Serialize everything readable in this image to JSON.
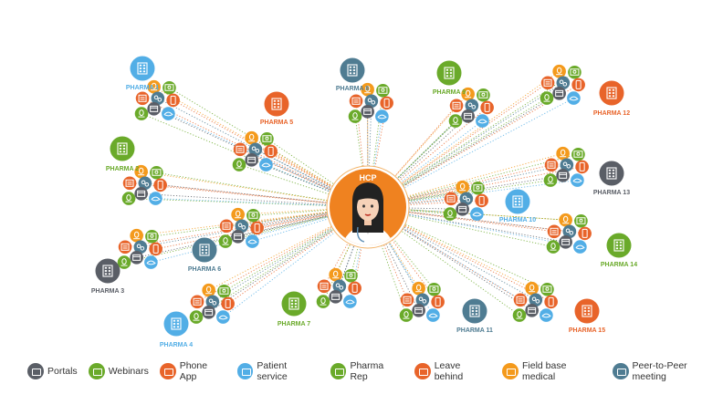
{
  "center": {
    "label": "HCP"
  },
  "colors": {
    "portals": "#5a5e66",
    "webinars": "#6aaa2a",
    "phone_app": "#e8642a",
    "patient_service": "#52aee6",
    "pharma_rep": "#6aaa2a",
    "leave_behind": "#e8642a",
    "field_base_medical": "#f49a1c",
    "peer_to_peer": "#4f7c92",
    "hcp": "#ef8220"
  },
  "pharmas": [
    {
      "label": "PHARMA 1",
      "color": "#52aee6"
    },
    {
      "label": "PHARMA 2",
      "color": "#6aaa2a"
    },
    {
      "label": "PHARMA 3",
      "color": "#5a5e66"
    },
    {
      "label": "PHARMA 4",
      "color": "#52aee6"
    },
    {
      "label": "PHARMA 5",
      "color": "#e8642a"
    },
    {
      "label": "PHARMA 6",
      "color": "#4f7c92"
    },
    {
      "label": "PHARMA 7",
      "color": "#6aaa2a"
    },
    {
      "label": "PHARMA 8",
      "color": "#4f7c92"
    },
    {
      "label": "PHARMA 9",
      "color": "#6aaa2a"
    },
    {
      "label": "PHARMA 10",
      "color": "#52aee6"
    },
    {
      "label": "PHARMA 11",
      "color": "#4f7c92"
    },
    {
      "label": "PHARMA 12",
      "color": "#e8642a"
    },
    {
      "label": "PHARMA 13",
      "color": "#5a5e66"
    },
    {
      "label": "PHARMA 14",
      "color": "#6aaa2a"
    },
    {
      "label": "PHARMA 15",
      "color": "#e8642a"
    }
  ],
  "legend": [
    {
      "label": "Portals",
      "icon": "portals-icon",
      "color": "#5a5e66"
    },
    {
      "label": "Webinars",
      "icon": "webinars-icon",
      "color": "#6aaa2a"
    },
    {
      "label": "Phone App",
      "icon": "phone-app-icon",
      "color": "#e8642a"
    },
    {
      "label": "Patient service",
      "icon": "patient-service-icon",
      "color": "#52aee6"
    },
    {
      "label": "Pharma Rep",
      "icon": "pharma-rep-icon",
      "color": "#6aaa2a"
    },
    {
      "label": "Leave behind",
      "icon": "leave-behind-icon",
      "color": "#e8642a"
    },
    {
      "label": "Field base medical",
      "icon": "field-base-medical-icon",
      "color": "#f49a1c"
    },
    {
      "label": "Peer-to-Peer meeting",
      "icon": "peer-to-peer-icon",
      "color": "#4f7c92"
    }
  ]
}
